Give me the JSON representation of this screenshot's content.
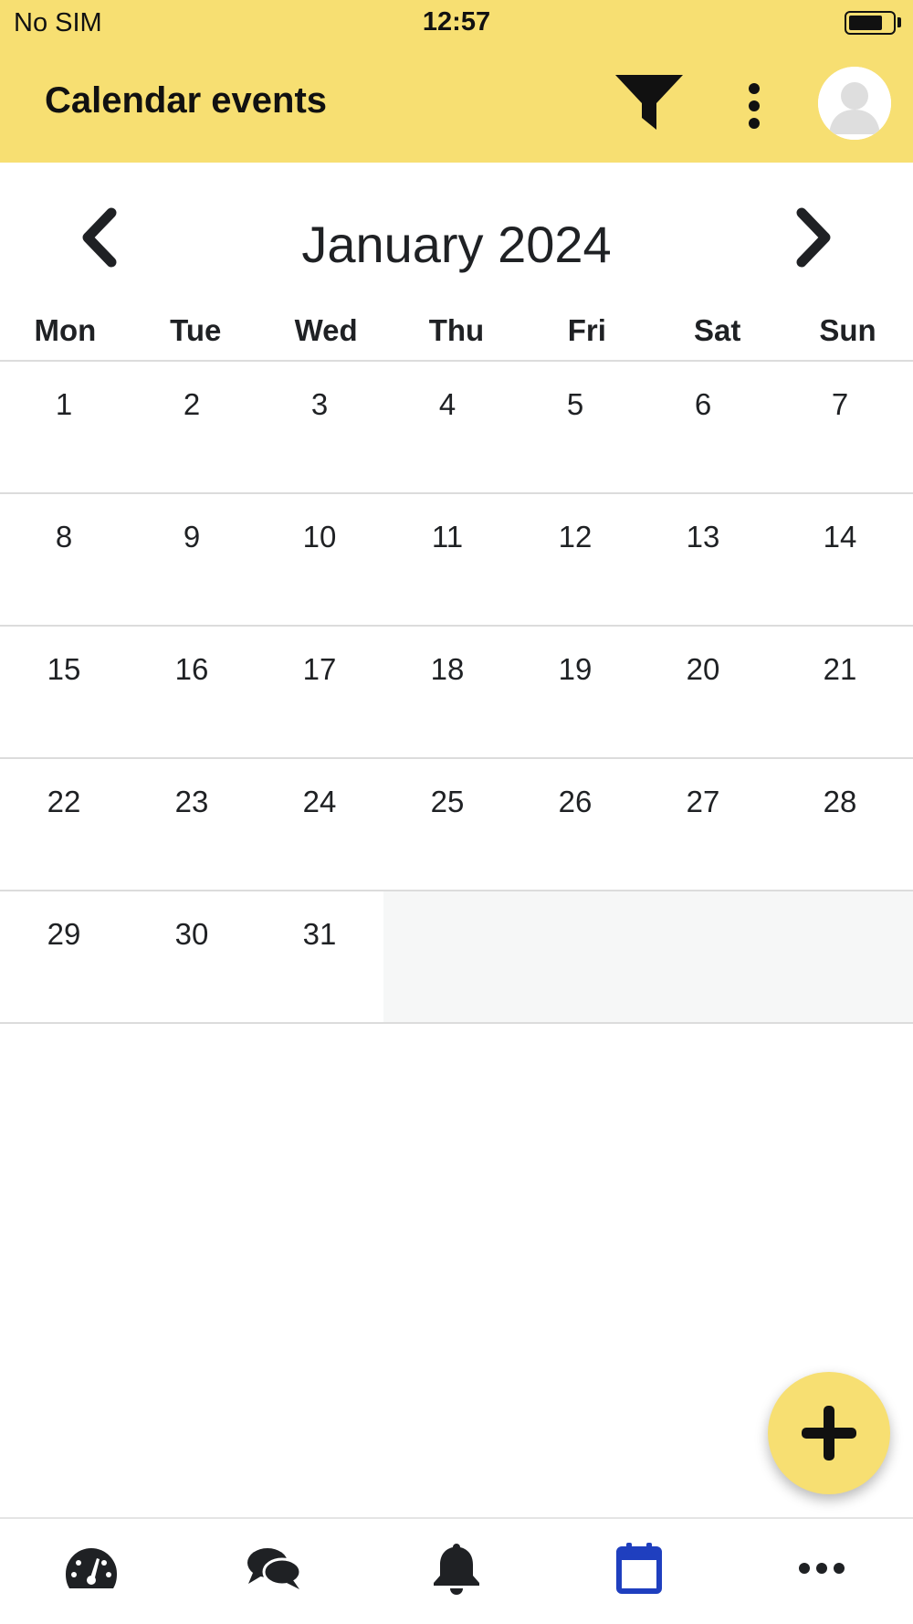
{
  "status_bar": {
    "carrier": "No SIM",
    "time": "12:57",
    "battery_level": 0.75
  },
  "header": {
    "title": "Calendar events",
    "filter_icon": "filter-icon",
    "more_icon": "more-vertical-icon",
    "avatar_icon": "user-avatar-icon"
  },
  "calendar": {
    "month_title": "January 2024",
    "prev_icon": "chevron-left-icon",
    "next_icon": "chevron-right-icon",
    "weekdays": [
      "Mon",
      "Tue",
      "Wed",
      "Thu",
      "Fri",
      "Sat",
      "Sun"
    ],
    "weeks": [
      [
        "1",
        "2",
        "3",
        "4",
        "5",
        "6",
        "7"
      ],
      [
        "8",
        "9",
        "10",
        "11",
        "12",
        "13",
        "14"
      ],
      [
        "15",
        "16",
        "17",
        "18",
        "19",
        "20",
        "21"
      ],
      [
        "22",
        "23",
        "24",
        "25",
        "26",
        "27",
        "28"
      ],
      [
        "29",
        "30",
        "31",
        "",
        "",
        "",
        ""
      ]
    ]
  },
  "fab": {
    "icon": "plus-icon"
  },
  "tabbar": {
    "items": [
      {
        "icon": "dashboard-gauge-icon",
        "active": false
      },
      {
        "icon": "chat-bubbles-icon",
        "active": false
      },
      {
        "icon": "bell-icon",
        "active": false
      },
      {
        "icon": "calendar-icon",
        "active": true
      },
      {
        "icon": "more-horizontal-icon",
        "active": false
      }
    ]
  },
  "colors": {
    "header_background": "#f7df72",
    "active_tab": "#1f3fbf",
    "inactive_tab": "#1f2124",
    "empty_day_background": "#f6f7f7"
  }
}
